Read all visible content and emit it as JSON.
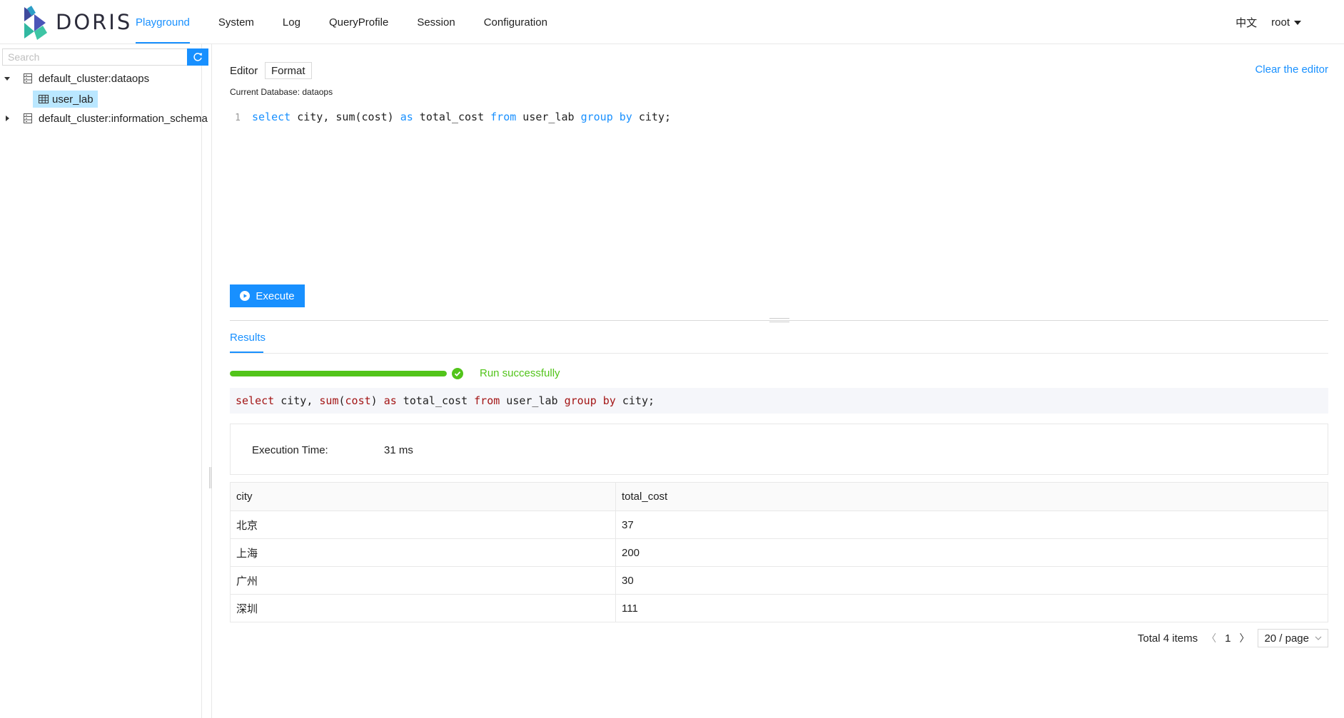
{
  "header": {
    "brand": "DORIS",
    "nav": [
      {
        "label": "Playground",
        "active": true
      },
      {
        "label": "System",
        "active": false
      },
      {
        "label": "Log",
        "active": false
      },
      {
        "label": "QueryProfile",
        "active": false
      },
      {
        "label": "Session",
        "active": false
      },
      {
        "label": "Configuration",
        "active": false
      }
    ],
    "language": "中文",
    "user": "root"
  },
  "sidebar": {
    "search_placeholder": "Search",
    "tree": [
      {
        "label": "default_cluster:dataops",
        "expanded": true,
        "children": [
          "user_lab"
        ]
      },
      {
        "label": "default_cluster:information_schema",
        "expanded": false
      }
    ]
  },
  "editor": {
    "label": "Editor",
    "format_label": "Format",
    "clear_label": "Clear the editor",
    "current_db": "Current Database: dataops",
    "line_no": "1",
    "sql_tokens": [
      "select",
      " city, sum(cost) ",
      "as",
      " total_cost ",
      "from",
      " user_lab ",
      "group",
      " ",
      "by",
      " city;"
    ],
    "execute_label": "Execute"
  },
  "results": {
    "tab_label": "Results",
    "progress": 1.0,
    "status": "Run successfully",
    "sql_tokens": [
      "select",
      " city, ",
      "sum",
      "(",
      "cost",
      ") ",
      "as",
      " total_cost ",
      "from",
      " user_lab ",
      "group",
      " ",
      "by",
      " city;"
    ],
    "exec_time_label": "Execution Time:",
    "exec_time_value": "31 ms",
    "columns": [
      "city",
      "total_cost"
    ],
    "rows": [
      [
        "北京",
        "37"
      ],
      [
        "上海",
        "200"
      ],
      [
        "广州",
        "30"
      ],
      [
        "深圳",
        "111"
      ]
    ],
    "total": "Total 4 items",
    "page": "1",
    "page_size": "20 / page"
  },
  "colors": {
    "accent": "#1890ff",
    "success": "#52c41a",
    "sql_keyword": "#a31515"
  }
}
